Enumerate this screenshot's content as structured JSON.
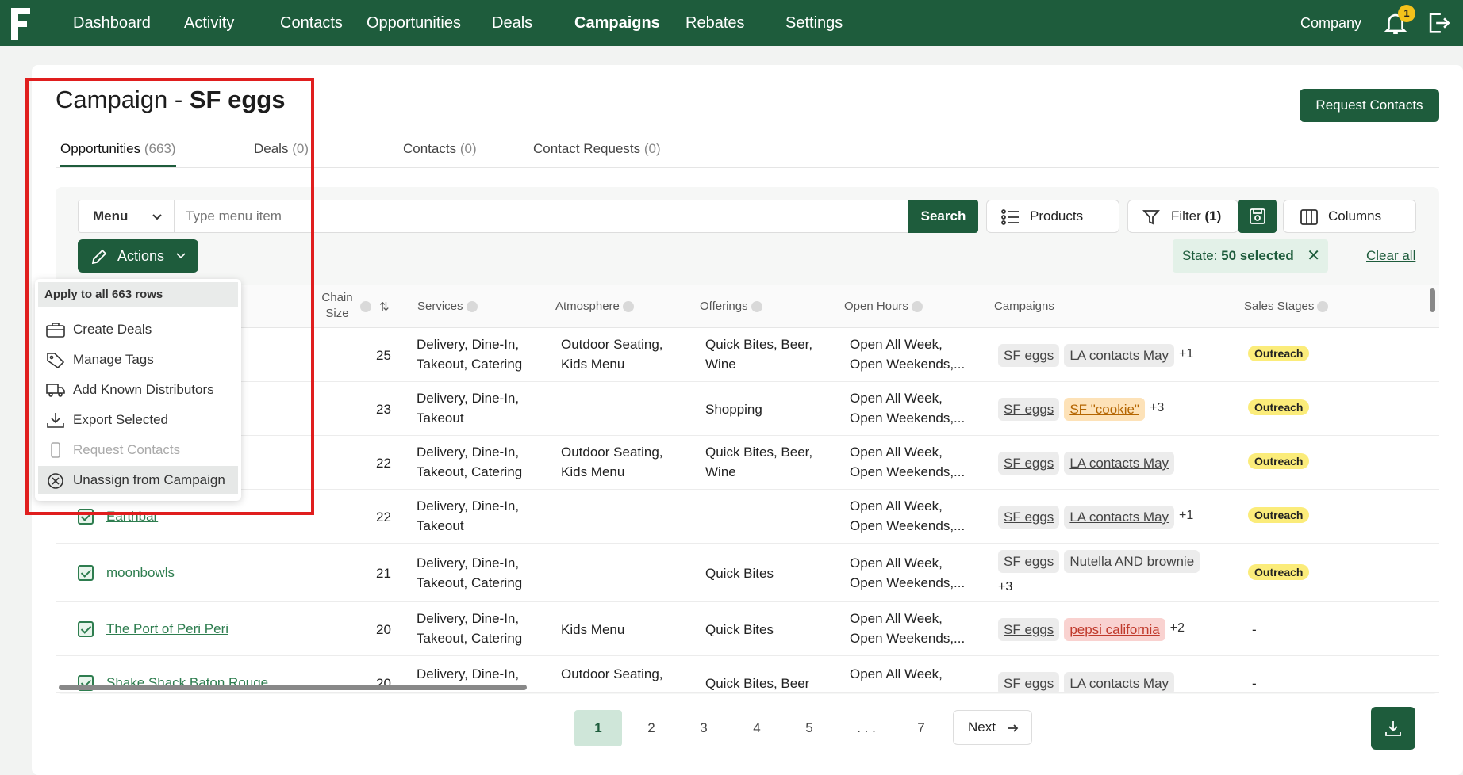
{
  "nav": {
    "items": [
      "Dashboard",
      "Activity",
      "Contacts",
      "Opportunities",
      "Deals",
      "Campaigns",
      "Rebates",
      "Settings"
    ],
    "active": "Campaigns",
    "company": "Company",
    "notification_count": "1"
  },
  "page": {
    "title_prefix": "Campaign - ",
    "title_name": "SF eggs",
    "request_contacts": "Request Contacts"
  },
  "tabs": [
    {
      "label": "Opportunities",
      "count": "(663)"
    },
    {
      "label": "Deals",
      "count": "(0)"
    },
    {
      "label": "Contacts",
      "count": "(0)"
    },
    {
      "label": "Contact Requests",
      "count": "(0)"
    }
  ],
  "search": {
    "menu_label": "Menu",
    "placeholder": "Type menu item",
    "search_label": "Search",
    "products_label": "Products",
    "filter_label": "Filter",
    "filter_count": "(1)",
    "columns_label": "Columns"
  },
  "actions": {
    "label": "Actions",
    "state_prefix": "State: ",
    "state_value": "50 selected",
    "clear_all": "Clear all"
  },
  "dropdown": {
    "header": "Apply to all 663 rows",
    "items": [
      "Create Deals",
      "Manage Tags",
      "Add Known Distributors",
      "Export Selected",
      "Request Contacts",
      "Unassign from Campaign"
    ]
  },
  "table": {
    "headers": {
      "chain_size": "Chain Size",
      "services": "Services",
      "atmosphere": "Atmosphere",
      "offerings": "Offerings",
      "open_hours": "Open Hours",
      "campaigns": "Campaigns",
      "sales_stages": "Sales Stages"
    },
    "rows": [
      {
        "name": "",
        "chain": "25",
        "services": [
          "Delivery, Dine-In,",
          "Takeout, Catering"
        ],
        "atmosphere": [
          "Outdoor Seating,",
          "Kids Menu"
        ],
        "offerings": [
          "Quick Bites, Beer,",
          "Wine"
        ],
        "hours": [
          "Open All Week,",
          "Open Weekends,..."
        ],
        "campaigns": [
          "SF eggs",
          "LA contacts May"
        ],
        "more": "+1",
        "stage": "Outreach"
      },
      {
        "name": "",
        "chain": "23",
        "services": [
          "Delivery, Dine-In,",
          "Takeout"
        ],
        "atmosphere": [
          ""
        ],
        "offerings": [
          "Shopping"
        ],
        "hours": [
          "Open All Week,",
          "Open Weekends,..."
        ],
        "campaigns": [
          "SF eggs",
          "SF \"cookie\""
        ],
        "more": "+3",
        "stage": "Outreach"
      },
      {
        "name": "",
        "chain": "22",
        "services": [
          "Delivery, Dine-In,",
          "Takeout, Catering"
        ],
        "atmosphere": [
          "Outdoor Seating,",
          "Kids Menu"
        ],
        "offerings": [
          "Quick Bites, Beer,",
          "Wine"
        ],
        "hours": [
          "Open All Week,",
          "Open Weekends,..."
        ],
        "campaigns": [
          "SF eggs",
          "LA contacts May"
        ],
        "more": "",
        "stage": "Outreach"
      },
      {
        "name": "Earthbar",
        "chain": "22",
        "services": [
          "Delivery, Dine-In,",
          "Takeout"
        ],
        "atmosphere": [
          ""
        ],
        "offerings": [
          ""
        ],
        "hours": [
          "Open All Week,",
          "Open Weekends,..."
        ],
        "campaigns": [
          "SF eggs",
          "LA contacts May"
        ],
        "more": "+1",
        "stage": "Outreach"
      },
      {
        "name": "moonbowls",
        "chain": "21",
        "services": [
          "Delivery, Dine-In,",
          "Takeout, Catering"
        ],
        "atmosphere": [
          ""
        ],
        "offerings": [
          "Quick Bites"
        ],
        "hours": [
          "Open All Week,",
          "Open Weekends,..."
        ],
        "campaigns": [
          "SF eggs",
          "Nutella AND brownie"
        ],
        "more": "+3",
        "stage": "Outreach"
      },
      {
        "name": "The Port of Peri Peri",
        "chain": "20",
        "services": [
          "Delivery, Dine-In,",
          "Takeout, Catering"
        ],
        "atmosphere": [
          "Kids Menu"
        ],
        "offerings": [
          "Quick Bites"
        ],
        "hours": [
          "Open All Week,",
          "Open Weekends,..."
        ],
        "campaigns": [
          "SF eggs",
          "pepsi california"
        ],
        "more": "+2",
        "stage": "-"
      },
      {
        "name": "Shake Shack Baton Rouge",
        "chain": "20",
        "services": [
          "Delivery, Dine-In,",
          ""
        ],
        "atmosphere": [
          "Outdoor Seating,",
          ""
        ],
        "offerings": [
          "Quick Bites, Beer"
        ],
        "hours": [
          "Open All Week,",
          ""
        ],
        "campaigns": [
          "SF eggs",
          "LA contacts May"
        ],
        "more": "",
        "stage": "-"
      }
    ]
  },
  "pagination": {
    "pages": [
      "1",
      "2",
      "3",
      "4",
      "5",
      ". . .",
      "7"
    ],
    "active": "1",
    "next": "Next"
  },
  "colors": {
    "brand": "#1e5c3c",
    "stage": "#fbec7a",
    "highlight_box": "#e01e1e"
  }
}
